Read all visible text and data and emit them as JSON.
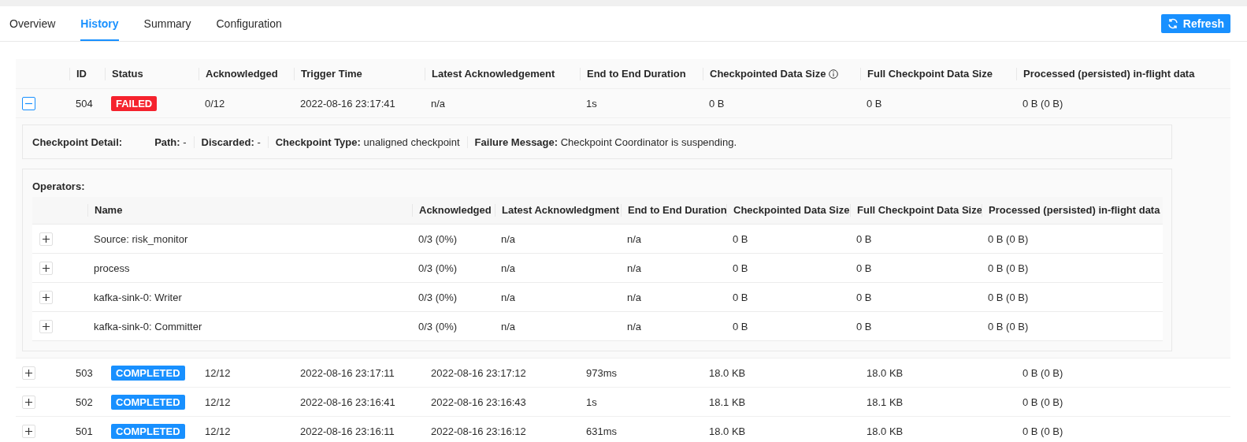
{
  "tabs": [
    {
      "label": "Overview",
      "selected": false
    },
    {
      "label": "History",
      "selected": true
    },
    {
      "label": "Summary",
      "selected": false
    },
    {
      "label": "Configuration",
      "selected": false
    }
  ],
  "refresh_button": {
    "label": "Refresh"
  },
  "table": {
    "columns": [
      {
        "label": "ID"
      },
      {
        "label": "Status"
      },
      {
        "label": "Acknowledged"
      },
      {
        "label": "Trigger Time"
      },
      {
        "label": "Latest Acknowledgement"
      },
      {
        "label": "End to End Duration"
      },
      {
        "label": "Checkpointed Data Size",
        "info": true
      },
      {
        "label": "Full Checkpoint Data Size"
      },
      {
        "label": "Processed (persisted) in-flight data"
      }
    ],
    "rows": [
      {
        "expanded": true,
        "id": "504",
        "status": {
          "label": "FAILED",
          "kind": "failed"
        },
        "acknowledged": "0/12",
        "trigger_time": "2022-08-16 23:17:41",
        "latest_ack": "n/a",
        "duration": "1s",
        "data_size": "0 B",
        "full_size": "0 B",
        "processed": "0 B (0 B)",
        "detail": {
          "title": "Checkpoint Detail:",
          "items": [
            "**Path:** -",
            "**Discarded:** -",
            "**Checkpoint Type:** unaligned checkpoint",
            "**Failure Message:** Checkpoint Coordinator is suspending."
          ],
          "operators": {
            "title": "Operators:",
            "columns": [
              "Name",
              "Acknowledged",
              "Latest Acknowledgment",
              "End to End Duration",
              "Checkpointed Data Size",
              "Full Checkpoint Data Size",
              "Processed (persisted) in-flight data"
            ],
            "rows": [
              {
                "expanded": false,
                "cells": [
                  "Source: risk_monitor",
                  "0/3 (0%)",
                  "n/a",
                  "n/a",
                  "0 B",
                  "0 B",
                  "0 B (0 B)"
                ]
              },
              {
                "expanded": false,
                "cells": [
                  "process",
                  "0/3 (0%)",
                  "n/a",
                  "n/a",
                  "0 B",
                  "0 B",
                  "0 B (0 B)"
                ]
              },
              {
                "expanded": false,
                "cells": [
                  "kafka-sink-0: Writer",
                  "0/3 (0%)",
                  "n/a",
                  "n/a",
                  "0 B",
                  "0 B",
                  "0 B (0 B)"
                ]
              },
              {
                "expanded": false,
                "cells": [
                  "kafka-sink-0: Committer",
                  "0/3 (0%)",
                  "n/a",
                  "n/a",
                  "0 B",
                  "0 B",
                  "0 B (0 B)"
                ]
              }
            ]
          }
        }
      },
      {
        "expanded": false,
        "id": "503",
        "status": {
          "label": "COMPLETED",
          "kind": "completed"
        },
        "acknowledged": "12/12",
        "trigger_time": "2022-08-16 23:17:11",
        "latest_ack": "2022-08-16 23:17:12",
        "duration": "973ms",
        "data_size": "18.0 KB",
        "full_size": "18.0 KB",
        "processed": "0 B (0 B)"
      },
      {
        "expanded": false,
        "id": "502",
        "status": {
          "label": "COMPLETED",
          "kind": "completed"
        },
        "acknowledged": "12/12",
        "trigger_time": "2022-08-16 23:16:41",
        "latest_ack": "2022-08-16 23:16:43",
        "duration": "1s",
        "data_size": "18.1 KB",
        "full_size": "18.1 KB",
        "processed": "0 B (0 B)"
      },
      {
        "expanded": false,
        "id": "501",
        "status": {
          "label": "COMPLETED",
          "kind": "completed"
        },
        "acknowledged": "12/12",
        "trigger_time": "2022-08-16 23:16:11",
        "latest_ack": "2022-08-16 23:16:12",
        "duration": "631ms",
        "data_size": "18.0 KB",
        "full_size": "18.0 KB",
        "processed": "0 B (0 B)"
      }
    ]
  }
}
